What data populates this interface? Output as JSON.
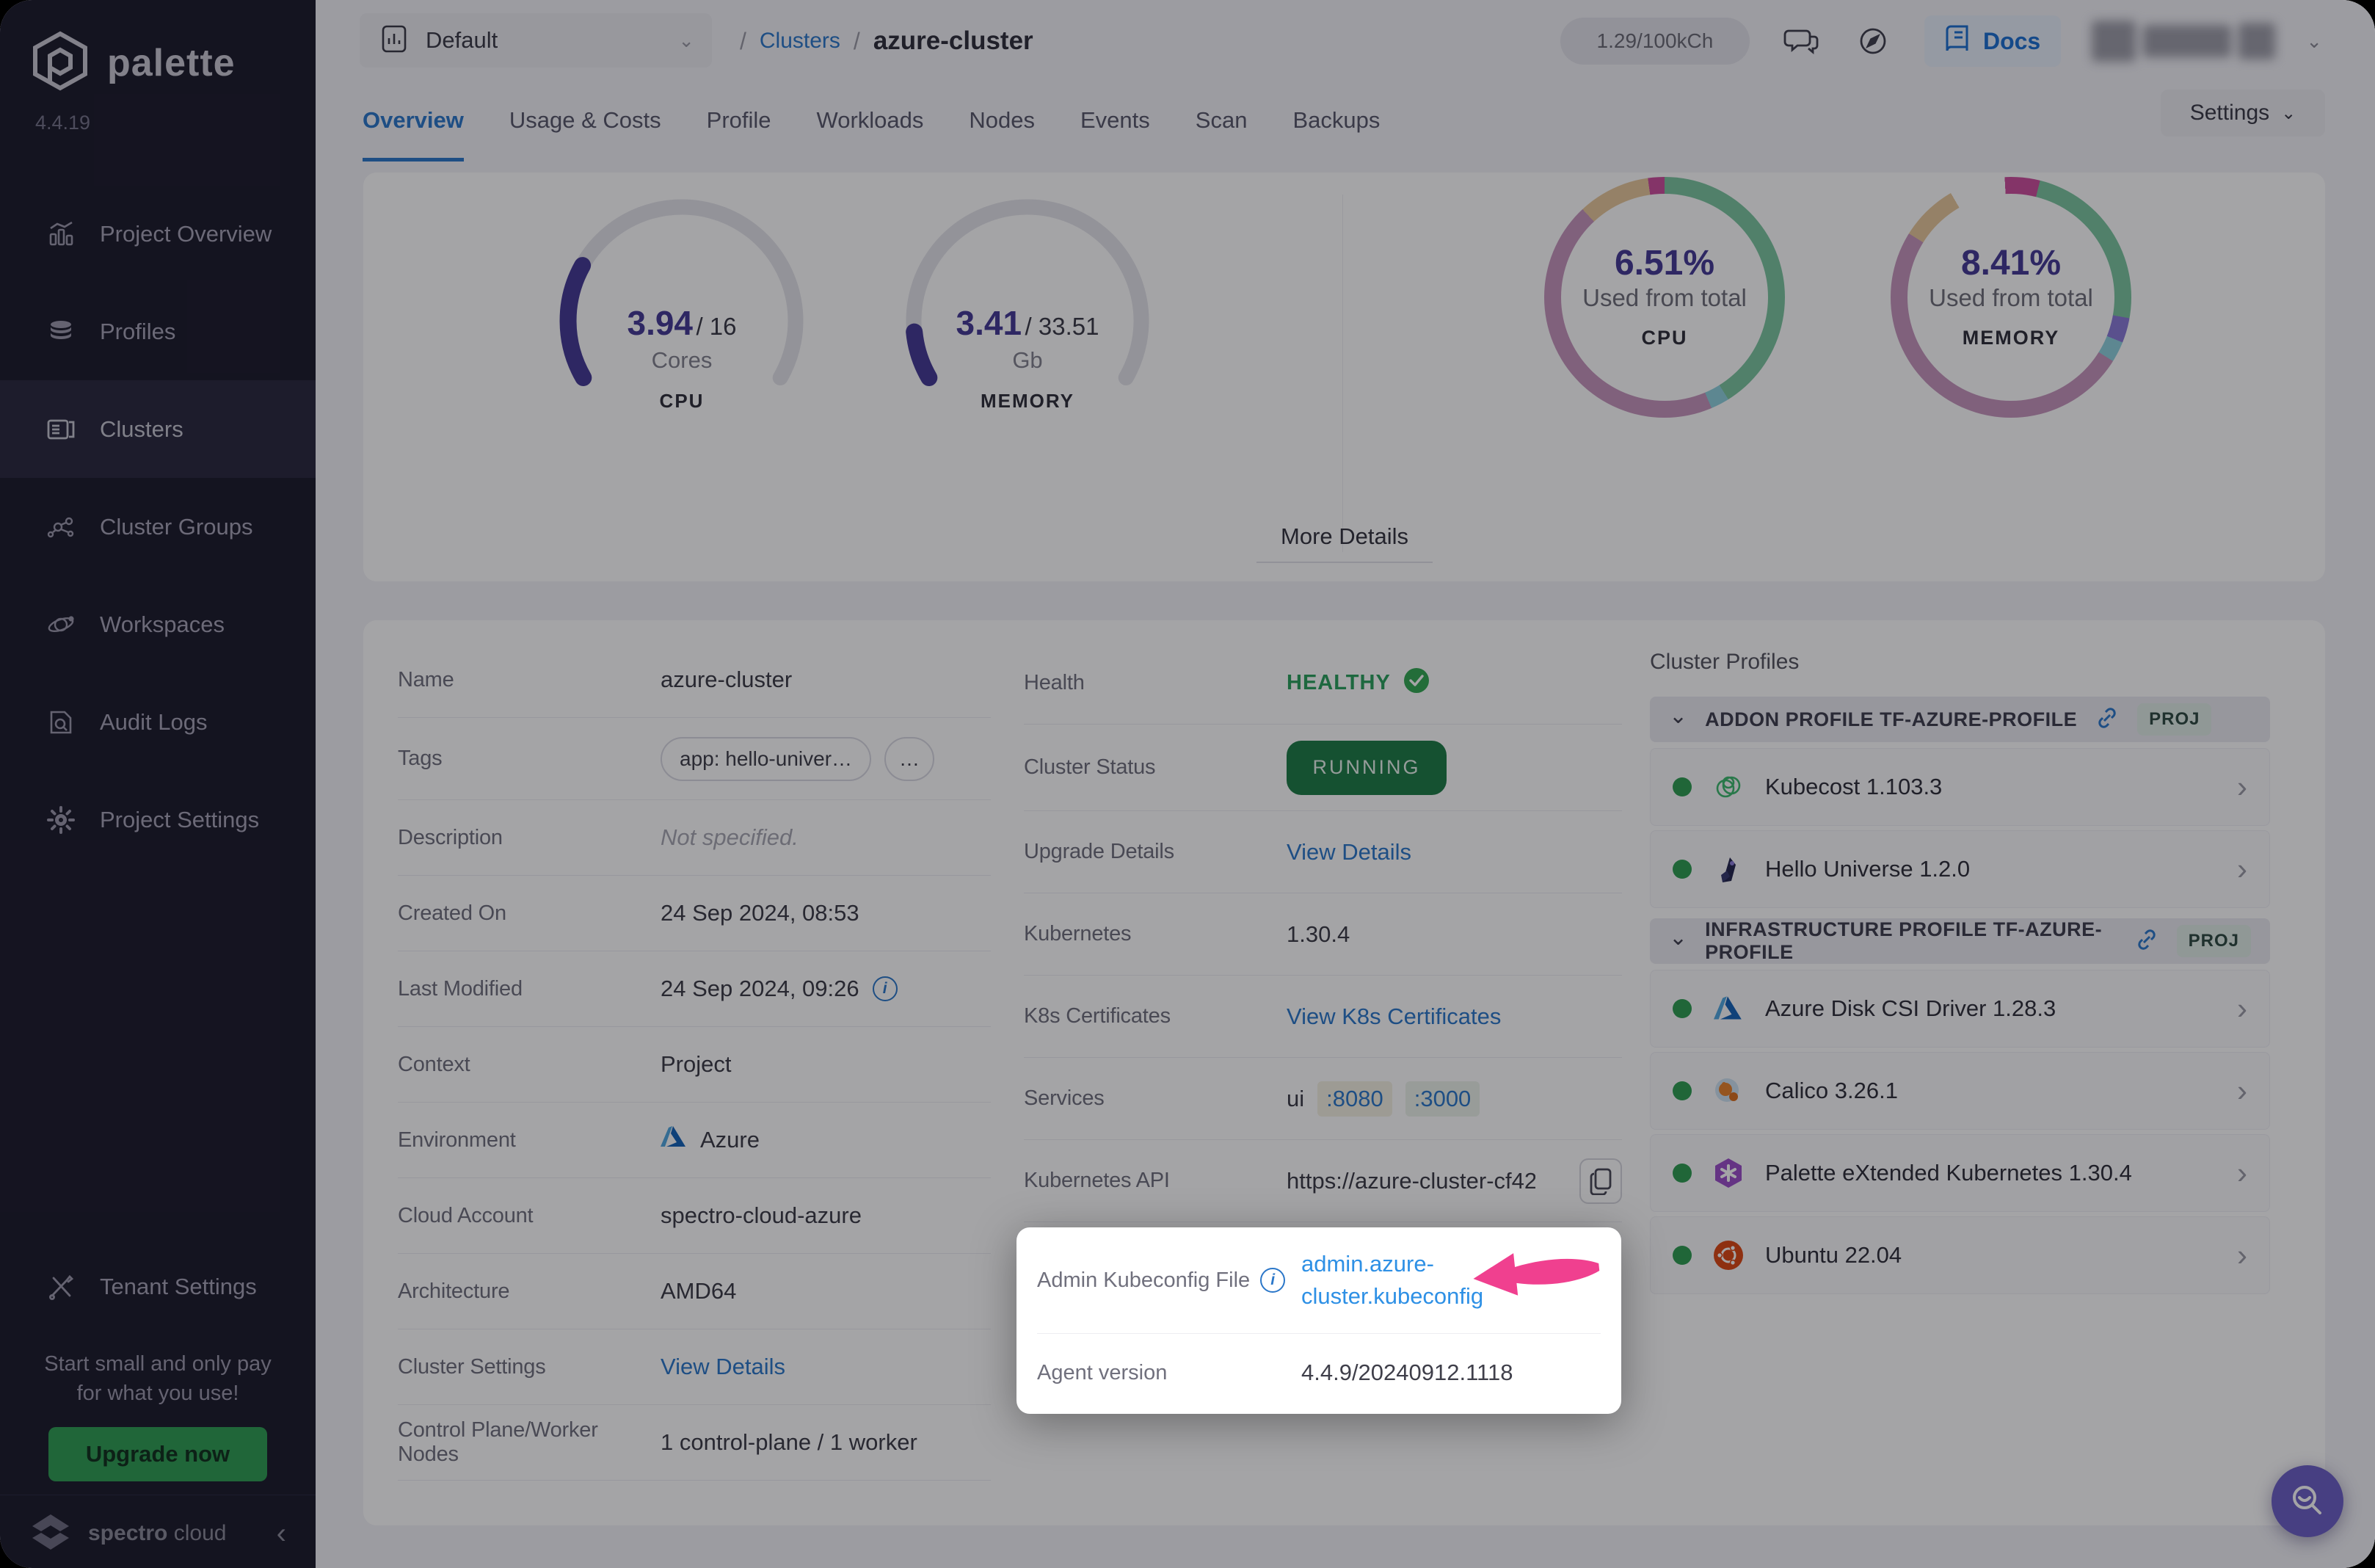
{
  "colors": {
    "accent_blue": "#2B77C9",
    "bright_link_blue": "#2E90E5",
    "docs_blue": "#1C6FD1",
    "healthy_green": "#2AA05C",
    "running_green": "#1E7C46",
    "status_dot_green": "#2E9E52",
    "upgrade_green": "#2F9E53",
    "gauge_purple": "#453A96",
    "pink_arrow": "#F0408F",
    "sidebar_bg": "#1C1B2C"
  },
  "sidebar": {
    "brand": "palette",
    "version": "4.4.19",
    "items": [
      {
        "label": "Project Overview"
      },
      {
        "label": "Profiles"
      },
      {
        "label": "Clusters"
      },
      {
        "label": "Cluster Groups"
      },
      {
        "label": "Workspaces"
      },
      {
        "label": "Audit Logs"
      },
      {
        "label": "Project Settings"
      }
    ],
    "tenant": "Tenant Settings",
    "promo_line1": "Start small and only pay",
    "promo_line2": "for what you use!",
    "upgrade_label": "Upgrade now",
    "footer_brand_bold": "spectro",
    "footer_brand_light": "cloud"
  },
  "topbar": {
    "project_selector": "Default",
    "breadcrumb_sep": "/",
    "breadcrumb_link": "Clusters",
    "breadcrumb_current": "azure-cluster",
    "usage_badge": "1.29/100kCh",
    "docs_label": "Docs"
  },
  "tabs": {
    "items": [
      "Overview",
      "Usage & Costs",
      "Profile",
      "Workloads",
      "Nodes",
      "Events",
      "Scan",
      "Backups"
    ],
    "active": "Overview",
    "settings_label": "Settings"
  },
  "overview": {
    "more_details": "More Details"
  },
  "chart_data": [
    {
      "type": "gauge",
      "label": "CPU",
      "value": 3.94,
      "max": 16,
      "unit": "Cores",
      "value_display": "3.94",
      "max_display": "/ 16",
      "start_angle": 240,
      "arc_degrees": 240,
      "color": "#453A96",
      "track": "#E5E5EB"
    },
    {
      "type": "gauge",
      "label": "MEMORY",
      "value": 3.41,
      "max": 33.51,
      "unit": "Gb",
      "value_display": "3.41",
      "max_display": "/ 33.51",
      "start_angle": 240,
      "arc_degrees": 240,
      "color": "#453A96",
      "track": "#E5E5EB"
    },
    {
      "type": "donut",
      "label": "CPU",
      "center_value": "6.51%",
      "center_caption": "Used from total",
      "segments": [
        {
          "color": "#7CC7A0",
          "from": 0,
          "to": 148
        },
        {
          "color": "#8FD2DE",
          "from": 148,
          "to": 157
        },
        {
          "color": "#C795BD",
          "from": 157,
          "to": 317
        },
        {
          "color": "#E8C89B",
          "from": 317,
          "to": 352
        },
        {
          "color": "#CC4F9D",
          "from": 352,
          "to": 360
        }
      ]
    },
    {
      "type": "donut",
      "label": "MEMORY",
      "center_value": "8.41%",
      "center_caption": "Used from total",
      "segments": [
        {
          "color": "#CC4F9D",
          "from": 0,
          "to": 14
        },
        {
          "color": "#7CC7A0",
          "from": 14,
          "to": 100
        },
        {
          "color": "#8B7BD8",
          "from": 100,
          "to": 112
        },
        {
          "color": "#8FD2DE",
          "from": 112,
          "to": 122
        },
        {
          "color": "#C795BD",
          "from": 122,
          "to": 302
        },
        {
          "color": "#E8C89B",
          "from": 302,
          "to": 330
        },
        {
          "color": "#FFFFFF",
          "from": 330,
          "to": 357
        },
        {
          "color": "#CC4F9D",
          "from": 357,
          "to": 360
        }
      ]
    }
  ],
  "details": {
    "left": [
      {
        "label": "Name",
        "value": "azure-cluster"
      },
      {
        "label": "Tags",
        "tags": [
          "app: hello-univer…",
          "…"
        ]
      },
      {
        "label": "Description",
        "value": "Not specified."
      },
      {
        "label": "Created On",
        "value": "24 Sep 2024, 08:53"
      },
      {
        "label": "Last Modified",
        "value": "24 Sep 2024, 09:26"
      },
      {
        "label": "Context",
        "value": "Project"
      },
      {
        "label": "Environment",
        "value": "Azure"
      },
      {
        "label": "Cloud Account",
        "value": "spectro-cloud-azure"
      },
      {
        "label": "Architecture",
        "value": "AMD64"
      },
      {
        "label": "Cluster Settings",
        "value": "View Details"
      },
      {
        "label": "Control Plane/Worker Nodes",
        "value": "1 control-plane / 1 worker"
      }
    ],
    "middle": [
      {
        "label": "Health",
        "value": "HEALTHY"
      },
      {
        "label": "Cluster Status",
        "value": "RUNNING"
      },
      {
        "label": "Upgrade Details",
        "value": "View Details"
      },
      {
        "label": "Kubernetes",
        "value": "1.30.4"
      },
      {
        "label": "K8s Certificates",
        "value": "View K8s Certificates"
      },
      {
        "label": "Services",
        "prefix": "ui",
        "ports": [
          ":8080",
          ":3000"
        ]
      },
      {
        "label": "Kubernetes API",
        "value": "https://azure-cluster-cf42…"
      }
    ]
  },
  "spotlight": {
    "kubeconfig_label": "Admin Kubeconfig File",
    "kubeconfig_line1": "admin.azure-",
    "kubeconfig_line2": "cluster.kubeconfig",
    "agent_label": "Agent version",
    "agent_value": "4.4.9/20240912.1118"
  },
  "profiles": {
    "title": "Cluster Profiles",
    "groups": [
      {
        "name": "ADDON PROFILE TF-AZURE-PROFILE",
        "badge": "PROJ",
        "items": [
          {
            "name": "Kubecost 1.103.3"
          },
          {
            "name": "Hello Universe 1.2.0"
          }
        ]
      },
      {
        "name": "INFRASTRUCTURE PROFILE TF-AZURE-PROFILE",
        "badge": "PROJ",
        "items": [
          {
            "name": "Azure Disk CSI Driver 1.28.3"
          },
          {
            "name": "Calico 3.26.1"
          },
          {
            "name": "Palette eXtended Kubernetes 1.30.4"
          },
          {
            "name": "Ubuntu 22.04"
          }
        ]
      }
    ]
  }
}
